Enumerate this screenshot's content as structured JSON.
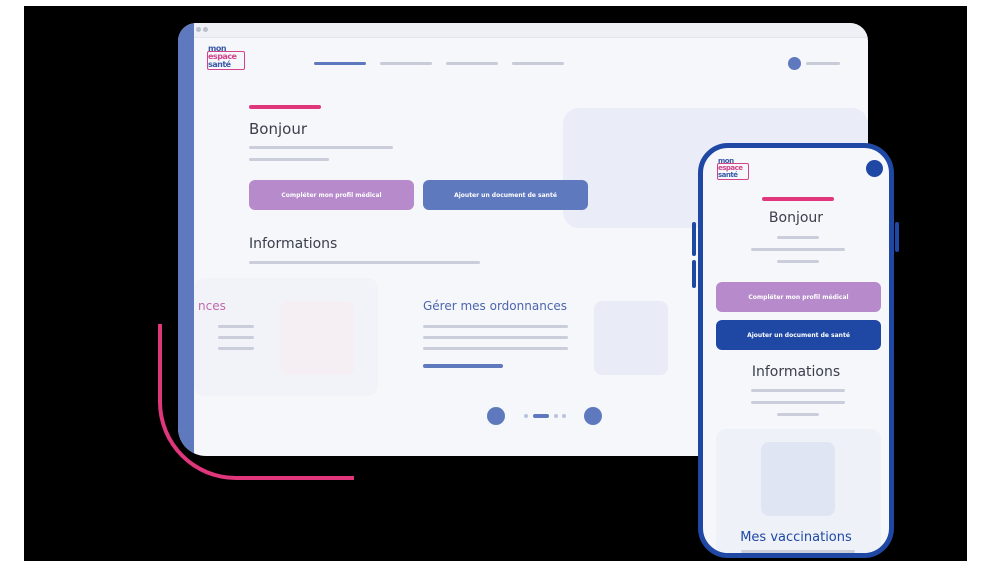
{
  "brand": {
    "logo_line1": "mon",
    "logo_line2": "espace",
    "logo_line3": "santé",
    "colors": {
      "primary_blue": "#5f79be",
      "dark_blue": "#1f48a4",
      "purple": "#b68acb",
      "pink": "#e0367c",
      "background": "#000000"
    }
  },
  "desktop": {
    "greeting": "Bonjour",
    "buttons": {
      "complete_profile": "Compléter mon profil médical",
      "add_document": "Ajouter un document de santé"
    },
    "informations_heading": "Informations",
    "cards": [
      {
        "title": "nces"
      },
      {
        "title": "Gérer mes ordonnances"
      }
    ],
    "carousel_icons": {
      "prev": "carousel-prev-icon",
      "next": "carousel-next-icon"
    },
    "avatar_icon": "user-avatar-icon"
  },
  "phone": {
    "greeting": "Bonjour",
    "buttons": {
      "complete_profile": "Compléter mon profil médical",
      "add_document": "Ajouter un document de santé"
    },
    "informations_heading": "Informations",
    "card_title": "Mes vaccinations",
    "avatar_icon": "user-avatar-icon"
  }
}
